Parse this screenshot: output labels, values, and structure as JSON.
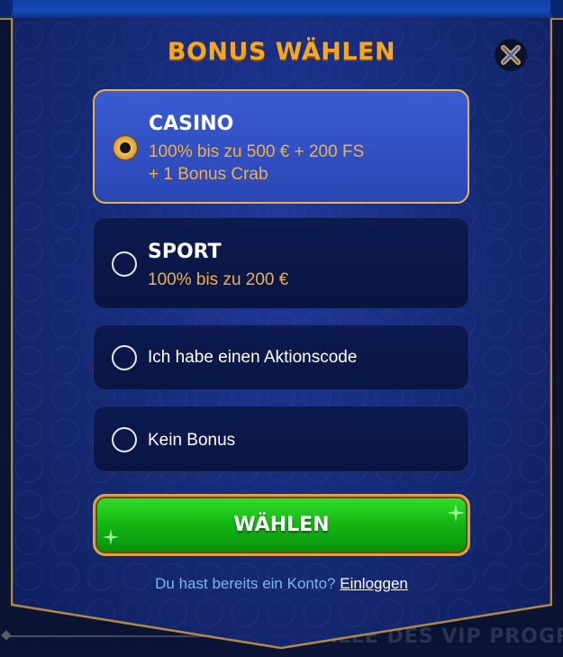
{
  "background": {
    "banner_text": "ALLE DES VIP PROGR"
  },
  "modal": {
    "title": "BONUS WÄHLEN",
    "close_icon": "close-x-icon"
  },
  "options": {
    "casino": {
      "title": "CASINO",
      "line1": "100% bis zu 500 € + 200 FS",
      "line2": "+ 1 Bonus Crab",
      "selected": true
    },
    "sport": {
      "title": "SPORT",
      "line1": "100% bis zu 200 €",
      "selected": false
    },
    "code": {
      "label": "Ich habe einen Aktionscode",
      "selected": false
    },
    "none": {
      "label": "Kein Bonus",
      "selected": false
    }
  },
  "cta": {
    "label": "WÄHLEN"
  },
  "footer": {
    "prompt": "Du hast bereits ein Konto?",
    "login_link": "Einloggen"
  },
  "colors": {
    "accent_gold": "#f5a623",
    "cta_green": "#14b514",
    "panel_blue": "#172b7a",
    "selected_option": "#2b47b4"
  }
}
